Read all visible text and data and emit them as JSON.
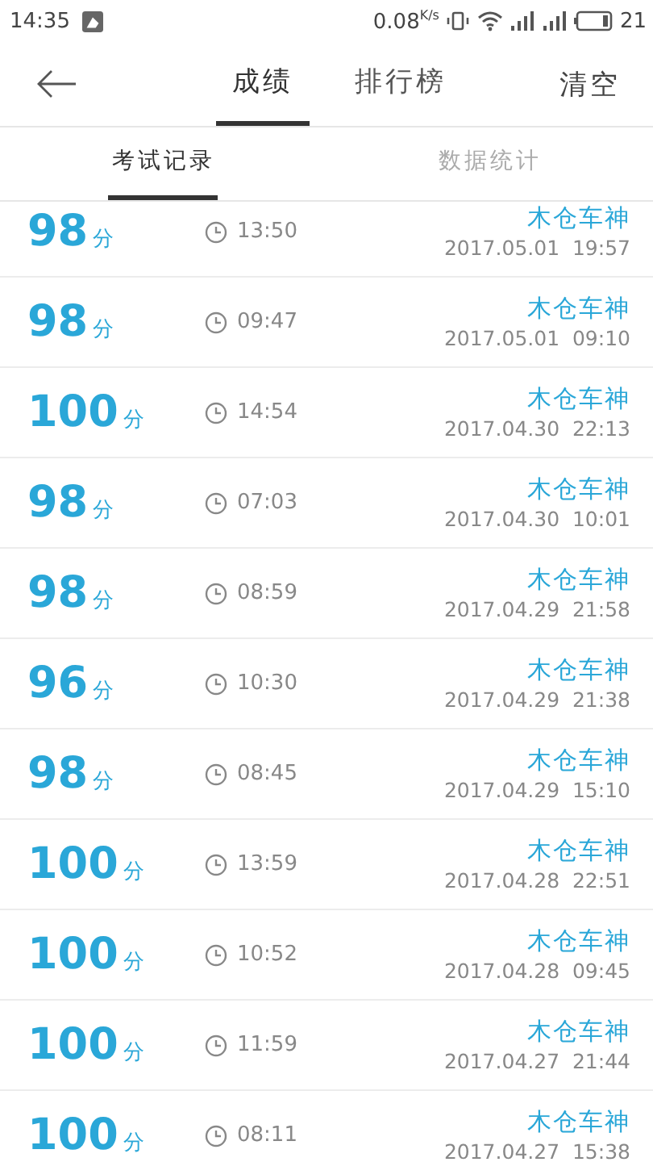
{
  "status_bar": {
    "time": "14:35",
    "speed": "0.08",
    "speed_unit": "K/s",
    "battery": "21"
  },
  "header": {
    "tabs": [
      {
        "label": "成绩",
        "selected": true
      },
      {
        "label": "排行榜",
        "selected": false
      }
    ],
    "action": "清空"
  },
  "subtabs": [
    {
      "label": "考试记录",
      "selected": true
    },
    {
      "label": "数据统计",
      "selected": false
    }
  ],
  "records": [
    {
      "score": "98",
      "unit": "分",
      "duration": "13:50",
      "name": "木仓车神",
      "datetime": "2017.05.01  19:57"
    },
    {
      "score": "98",
      "unit": "分",
      "duration": "09:47",
      "name": "木仓车神",
      "datetime": "2017.05.01  09:10"
    },
    {
      "score": "100",
      "unit": "分",
      "duration": "14:54",
      "name": "木仓车神",
      "datetime": "2017.04.30  22:13"
    },
    {
      "score": "98",
      "unit": "分",
      "duration": "07:03",
      "name": "木仓车神",
      "datetime": "2017.04.30  10:01"
    },
    {
      "score": "98",
      "unit": "分",
      "duration": "08:59",
      "name": "木仓车神",
      "datetime": "2017.04.29  21:58"
    },
    {
      "score": "96",
      "unit": "分",
      "duration": "10:30",
      "name": "木仓车神",
      "datetime": "2017.04.29  21:38"
    },
    {
      "score": "98",
      "unit": "分",
      "duration": "08:45",
      "name": "木仓车神",
      "datetime": "2017.04.29  15:10"
    },
    {
      "score": "100",
      "unit": "分",
      "duration": "13:59",
      "name": "木仓车神",
      "datetime": "2017.04.28  22:51"
    },
    {
      "score": "100",
      "unit": "分",
      "duration": "10:52",
      "name": "木仓车神",
      "datetime": "2017.04.28  09:45"
    },
    {
      "score": "100",
      "unit": "分",
      "duration": "11:59",
      "name": "木仓车神",
      "datetime": "2017.04.27  21:44"
    },
    {
      "score": "100",
      "unit": "分",
      "duration": "08:11",
      "name": "木仓车神",
      "datetime": "2017.04.27  15:38"
    }
  ]
}
